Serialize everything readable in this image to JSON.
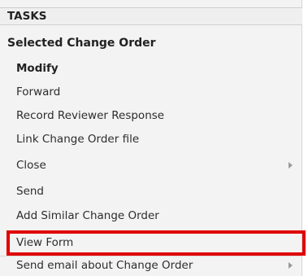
{
  "panel": {
    "header": "TASKS",
    "section_title": "Selected Change Order",
    "items": [
      {
        "label": "Modify",
        "bold": true,
        "has_submenu": false
      },
      {
        "label": "Forward",
        "bold": false,
        "has_submenu": false
      },
      {
        "label": "Record Reviewer Response",
        "bold": false,
        "has_submenu": false
      },
      {
        "label": "Link Change Order file",
        "bold": false,
        "has_submenu": false
      },
      {
        "label": "Close",
        "bold": false,
        "has_submenu": true
      },
      {
        "label": "Send",
        "bold": false,
        "has_submenu": false
      },
      {
        "label": "Add Similar Change Order",
        "bold": false,
        "has_submenu": false
      },
      {
        "label": "View Form",
        "bold": false,
        "has_submenu": false
      },
      {
        "label": "Send email about Change Order",
        "bold": false,
        "has_submenu": true
      }
    ]
  },
  "colors": {
    "highlight_border": "#e00000",
    "panel_bg": "#f3f3f3",
    "submenu_arrow": "#9a9a9a"
  }
}
